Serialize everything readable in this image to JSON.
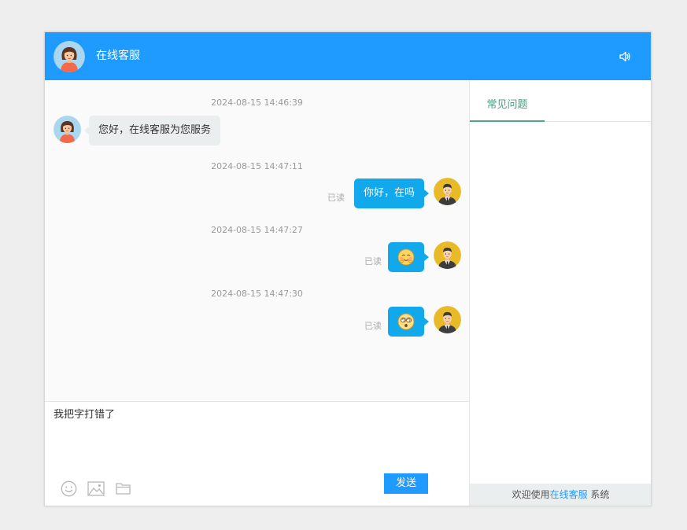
{
  "header": {
    "title": "在线客服",
    "speaker_icon": "speaker-icon",
    "bg_color": "#1f9bff"
  },
  "messages": [
    {
      "time": "2024-08-15 14:46:39",
      "side": "agent",
      "text": "您好，在线客服为您服务"
    },
    {
      "time": "2024-08-15 14:47:11",
      "side": "user",
      "text": "你好，在吗",
      "status": "已读"
    },
    {
      "time": "2024-08-15 14:47:27",
      "side": "user",
      "emoji": "smiling-emoji",
      "status": "已读"
    },
    {
      "time": "2024-08-15 14:47:30",
      "side": "user",
      "emoji": "dizzy-emoji",
      "status": "已读"
    }
  ],
  "input": {
    "value": "我把字打错了",
    "send_label": "发送",
    "tools": [
      "emoji-icon",
      "image-icon",
      "folder-icon"
    ]
  },
  "sidebar": {
    "tab_label": "常见问题",
    "footer_prefix": "欢迎使用",
    "footer_link": "在线客服",
    "footer_suffix": " 系统"
  },
  "colors": {
    "primary": "#1f9bff",
    "bubble_user": "#12a8ec",
    "bubble_agent": "#eaeeef",
    "tab_accent": "#4ea983"
  }
}
